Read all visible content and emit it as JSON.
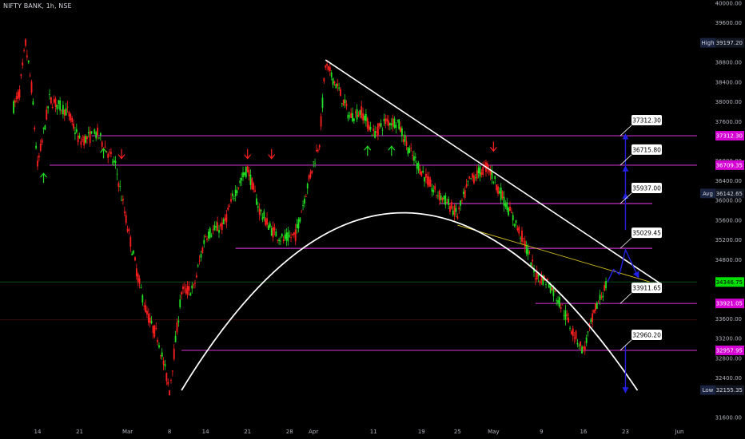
{
  "header": {
    "title": "NIFTY BANK, 1h, NSE"
  },
  "colors": {
    "background": "#000000",
    "bull_candle": "#22e022",
    "bear_candle": "#ff1f1f",
    "level_line": "#c030c0",
    "trend_line": "#ffffff",
    "projection": "#2020e0",
    "last_price": "#00e000",
    "magenta_badge": "#d400d4",
    "high_low_badge": "#1a2340"
  },
  "chart_data": {
    "type": "candlestick",
    "instrument": "NIFTY BANK",
    "interval": "1h",
    "exchange": "NSE",
    "ylim": [
      31600,
      40000
    ],
    "y_ticks": [
      "40000.00",
      "39600.00",
      "38800.00",
      "38400.00",
      "38000.00",
      "37600.00",
      "36800.00",
      "36400.00",
      "36000.00",
      "35600.00",
      "35200.00",
      "34800.00",
      "33600.00",
      "33200.00",
      "32800.00",
      "32400.00",
      "31600.00"
    ],
    "x_tick_labels": [
      "14",
      "21",
      "Mar",
      "8",
      "14",
      "21",
      "28",
      "Apr",
      "11",
      "19",
      "25",
      "May",
      "9",
      "16",
      "23",
      "Jun"
    ],
    "price_series": [
      {
        "date": "2022-02-10",
        "close": 37900
      },
      {
        "date": "2022-02-11",
        "close": 38200
      },
      {
        "date": "2022-02-12",
        "close": 39180
      },
      {
        "date": "2022-02-13",
        "close": 38300
      },
      {
        "date": "2022-02-14",
        "close": 36700
      },
      {
        "date": "2022-02-16",
        "close": 38050
      },
      {
        "date": "2022-02-19",
        "close": 37800
      },
      {
        "date": "2022-02-21",
        "close": 37200
      },
      {
        "date": "2022-02-24",
        "close": 37350
      },
      {
        "date": "2022-02-27",
        "close": 36700
      },
      {
        "date": "2022-03-01",
        "close": 35450
      },
      {
        "date": "2022-03-03",
        "close": 34300
      },
      {
        "date": "2022-03-04",
        "close": 33800
      },
      {
        "date": "2022-03-05",
        "close": 33450
      },
      {
        "date": "2022-03-06",
        "close": 33250
      },
      {
        "date": "2022-03-08",
        "close": 32150
      },
      {
        "date": "2022-03-10",
        "close": 34150
      },
      {
        "date": "2022-03-12",
        "close": 34200
      },
      {
        "date": "2022-03-14",
        "close": 35300
      },
      {
        "date": "2022-03-17",
        "close": 35500
      },
      {
        "date": "2022-03-19",
        "close": 36200
      },
      {
        "date": "2022-03-21",
        "close": 36650
      },
      {
        "date": "2022-03-23",
        "close": 35800
      },
      {
        "date": "2022-03-25",
        "close": 35400
      },
      {
        "date": "2022-03-27",
        "close": 35200
      },
      {
        "date": "2022-03-29",
        "close": 35300
      },
      {
        "date": "2022-03-31",
        "close": 36300
      },
      {
        "date": "2022-04-02",
        "close": 37200
      },
      {
        "date": "2022-04-03",
        "close": 38750
      },
      {
        "date": "2022-04-05",
        "close": 38300
      },
      {
        "date": "2022-04-07",
        "close": 37700
      },
      {
        "date": "2022-04-09",
        "close": 37800
      },
      {
        "date": "2022-04-11",
        "close": 37350
      },
      {
        "date": "2022-04-13",
        "close": 37600
      },
      {
        "date": "2022-04-15",
        "close": 37600
      },
      {
        "date": "2022-04-17",
        "close": 37000
      },
      {
        "date": "2022-04-19",
        "close": 36600
      },
      {
        "date": "2022-04-21",
        "close": 36200
      },
      {
        "date": "2022-04-23",
        "close": 36000
      },
      {
        "date": "2022-04-25",
        "close": 35700
      },
      {
        "date": "2022-04-27",
        "close": 36400
      },
      {
        "date": "2022-04-30",
        "close": 36700
      },
      {
        "date": "2022-05-02",
        "close": 36200
      },
      {
        "date": "2022-05-04",
        "close": 35700
      },
      {
        "date": "2022-05-06",
        "close": 35200
      },
      {
        "date": "2022-05-08",
        "close": 34500
      },
      {
        "date": "2022-05-10",
        "close": 34350
      },
      {
        "date": "2022-05-12",
        "close": 33950
      },
      {
        "date": "2022-05-14",
        "close": 33400
      },
      {
        "date": "2022-05-16",
        "close": 32950
      },
      {
        "date": "2022-05-18",
        "close": 33800
      },
      {
        "date": "2022-05-20",
        "close": 34346.75
      }
    ],
    "levels": [
      {
        "name": "resistance-37312",
        "price": 37312.3,
        "label": "37312.30",
        "badge": "37312.30",
        "from": "2022-02-23"
      },
      {
        "name": "resistance-36715",
        "price": 36715.8,
        "label": "36715.80",
        "badge": "36709.35",
        "from": "2022-02-16"
      },
      {
        "name": "level-35937",
        "price": 35937.0,
        "label": "35937.00",
        "from": "2022-04-22"
      },
      {
        "name": "level-35029",
        "price": 35029.45,
        "label": "35029.45",
        "from": "2022-03-19"
      },
      {
        "name": "support-33911",
        "price": 33911.65,
        "label": "33911.65",
        "badge": "33921.05",
        "from": "2022-05-08"
      },
      {
        "name": "support-32960",
        "price": 32960.2,
        "label": "32960.20",
        "badge": "32957.95",
        "from": "2022-03-10"
      }
    ],
    "trendline": {
      "points": [
        {
          "date": "2022-04-03",
          "price": 38850
        },
        {
          "date": "2022-05-29",
          "price": 34300
        }
      ]
    },
    "yellow_line": {
      "points": [
        {
          "date": "2022-04-25",
          "price": 35500
        },
        {
          "date": "2022-05-27",
          "price": 34350
        }
      ]
    },
    "arc": {
      "start": {
        "date": "2022-03-10",
        "price": 32150
      },
      "peak": {
        "date": "2022-04-15",
        "price": 35750
      },
      "end": {
        "date": "2022-05-25",
        "price": 32150
      }
    },
    "projection_path": [
      {
        "date": "2022-05-20",
        "price": 34346.75
      },
      {
        "date": "2022-05-21",
        "price": 34600
      },
      {
        "date": "2022-05-22",
        "price": 34500
      },
      {
        "date": "2022-05-23",
        "price": 35000
      },
      {
        "date": "2022-05-25",
        "price": 34480
      }
    ],
    "targets": [
      {
        "date": "2022-05-23",
        "from": 35400,
        "to": 36100
      },
      {
        "date": "2022-05-23",
        "from": 36100,
        "to": 36650
      },
      {
        "date": "2022-05-23",
        "from": 36650,
        "to": 37300
      },
      {
        "date": "2022-05-23",
        "from": 33050,
        "to": 32150
      }
    ],
    "up_arrows": [
      {
        "date": "2022-02-15",
        "price": 36550
      },
      {
        "date": "2022-02-25",
        "price": 37050
      },
      {
        "date": "2022-04-10",
        "price": 37100
      },
      {
        "date": "2022-04-14",
        "price": 37100
      }
    ],
    "down_arrows": [
      {
        "date": "2022-02-28",
        "price": 36850
      },
      {
        "date": "2022-03-21",
        "price": 36850
      },
      {
        "date": "2022-03-25",
        "price": 36850
      },
      {
        "date": "2022-05-01",
        "price": 37000
      }
    ],
    "price_badges": [
      {
        "key": "high",
        "label": "High",
        "value": "39197.20",
        "price": 39197.2
      },
      {
        "key": "avg",
        "label": "Avg",
        "value": "36142.65",
        "price": 36142.65
      },
      {
        "key": "last",
        "label": "",
        "value": "34346.75",
        "price": 34346.75
      },
      {
        "key": "low",
        "label": "Low",
        "value": "32155.35",
        "price": 32155.35
      }
    ]
  }
}
